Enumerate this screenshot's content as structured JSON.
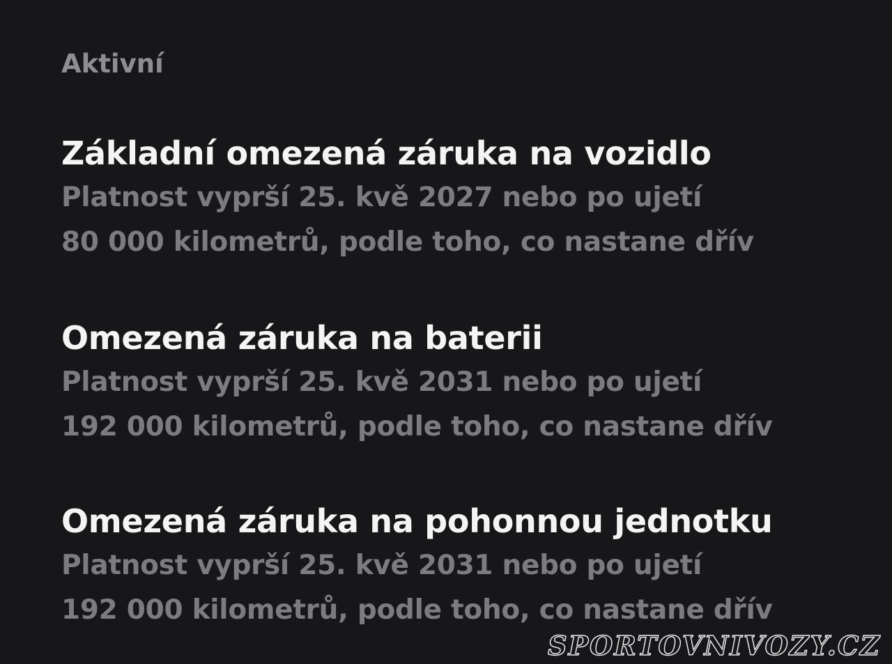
{
  "section": {
    "title": "Aktivní"
  },
  "warranties": [
    {
      "title": "Základní omezená záruka na vozidlo",
      "line1": "Platnost vyprší 25. kvě 2027 nebo po ujetí",
      "line2": "80 000 kilometrů, podle toho, co nastane dřív"
    },
    {
      "title": "Omezená záruka na baterii",
      "line1": "Platnost vyprší 25. kvě 2031 nebo po ujetí",
      "line2": "192 000 kilometrů, podle toho, co nastane dřív"
    },
    {
      "title": "Omezená záruka na pohonnou jednotku",
      "line1": "Platnost vyprší 25. kvě 2031 nebo po ujetí",
      "line2": "192 000 kilometrů, podle toho, co nastane dřív"
    }
  ],
  "watermark": "SPORTOVNIVOZY.CZ"
}
